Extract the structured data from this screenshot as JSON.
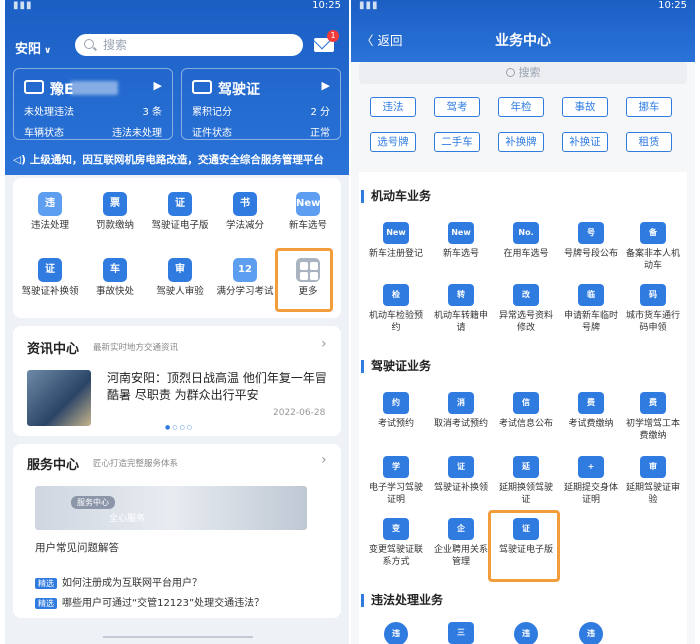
{
  "left": {
    "status_time": "10:25",
    "city": "安阳",
    "search_placeholder": "搜索",
    "mail_badge": "1",
    "vehicle_card": {
      "plate": "豫E",
      "row1_label": "未处理违法",
      "row1_value": "3 条",
      "row2_label": "车辆状态",
      "row2_value": "违法未处理"
    },
    "license_card": {
      "title": "驾驶证",
      "row1_label": "累积记分",
      "row1_value": "2 分",
      "row2_label": "证件状态",
      "row2_value": "正常"
    },
    "notice": "上级通知，因互联网机房电路改造，交通安全综合服务管理平台",
    "grid": [
      {
        "label": "违法处理",
        "icon": "违"
      },
      {
        "label": "罚款缴纳",
        "icon": "票"
      },
      {
        "label": "驾驶证电子版",
        "icon": "证"
      },
      {
        "label": "学法减分",
        "icon": "书"
      },
      {
        "label": "新车选号",
        "icon": "New"
      },
      {
        "label": "驾驶证补换领",
        "icon": "证"
      },
      {
        "label": "事故快处",
        "icon": "车"
      },
      {
        "label": "驾驶人审验",
        "icon": "审"
      },
      {
        "label": "满分学习考试",
        "icon": "12"
      },
      {
        "label": "更多",
        "icon": ""
      }
    ],
    "news": {
      "title": "资讯中心",
      "sub": "最新实时地方交通资讯",
      "headline": "河南安阳：顶烈日战高温 他们年复一年冒酷暑 尽职责 为群众出行平安",
      "date": "2022-06-28"
    },
    "service": {
      "title": "服务中心",
      "sub": "匠心打造完整服务体系",
      "img_tag": "服务中心",
      "img_text": "全心服务",
      "faq_title": "用户常见问题解答",
      "faq_tag": "精选",
      "faq1": "如何注册成为互联网平台用户？",
      "faq2": "哪些用户可通过“交管12123”处理交通违法？"
    }
  },
  "right": {
    "back": "返回",
    "title": "业务中心",
    "search_placeholder": "搜索",
    "chips": [
      "违法",
      "驾考",
      "年检",
      "事故",
      "挪车",
      "选号牌",
      "二手车",
      "补换牌",
      "补换证",
      "租赁"
    ],
    "sec1": "机动车业务",
    "sec1_items": [
      {
        "label": "新车注册登记",
        "icon": "New"
      },
      {
        "label": "新车选号",
        "icon": "New"
      },
      {
        "label": "在用车选号",
        "icon": "No."
      },
      {
        "label": "号牌号段公布",
        "icon": "号"
      },
      {
        "label": "备案非本人机动车",
        "icon": "备"
      },
      {
        "label": "机动车检验预约",
        "icon": "检"
      },
      {
        "label": "机动车转籍申请",
        "icon": "转"
      },
      {
        "label": "异常选号资料修改",
        "icon": "改"
      },
      {
        "label": "申请新车临时号牌",
        "icon": "临"
      },
      {
        "label": "城市货车通行码申领",
        "icon": "码"
      }
    ],
    "sec2": "驾驶证业务",
    "sec2_items": [
      {
        "label": "考试预约",
        "icon": "约"
      },
      {
        "label": "取消考试预约",
        "icon": "消"
      },
      {
        "label": "考试信息公布",
        "icon": "信"
      },
      {
        "label": "考试费缴纳",
        "icon": "费"
      },
      {
        "label": "初学增驾工本费缴纳",
        "icon": "费"
      },
      {
        "label": "电子学习驾驶证明",
        "icon": "学"
      },
      {
        "label": "驾驶证补换领",
        "icon": "证"
      },
      {
        "label": "延期换领驾驶证",
        "icon": "延"
      },
      {
        "label": "延期提交身体证明",
        "icon": "+"
      },
      {
        "label": "延期驾驶证审验",
        "icon": "审"
      },
      {
        "label": "变更驾驶证联系方式",
        "icon": "变"
      },
      {
        "label": "企业聘用关系管理",
        "icon": "企"
      },
      {
        "label": "驾驶证电子版",
        "icon": "证"
      }
    ],
    "sec3": "违法处理业务",
    "sec3_icons": [
      "违",
      "三",
      "违",
      "违"
    ]
  }
}
